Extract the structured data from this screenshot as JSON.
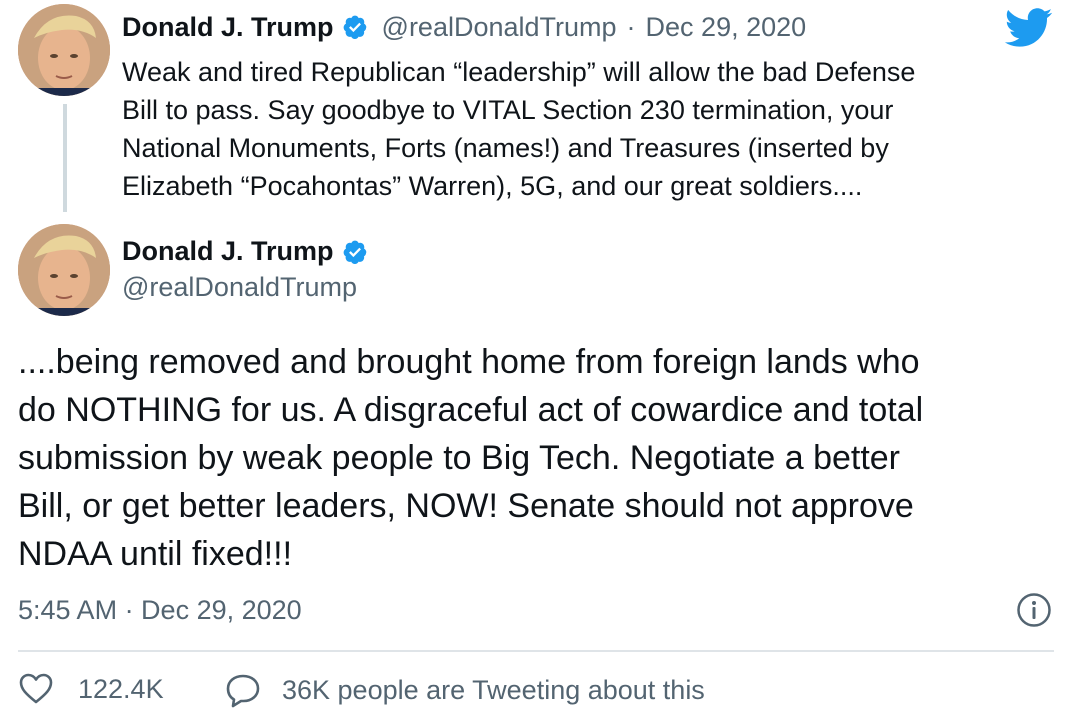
{
  "colors": {
    "accent": "#1d9bf0",
    "muted": "#536471",
    "text": "#0f1419"
  },
  "icons": {
    "logo": "twitter-bird-icon",
    "verified": "verified-badge-icon",
    "info": "info-icon",
    "like": "heart-icon",
    "reply": "speech-bubble-icon"
  },
  "parent_tweet": {
    "author_name": "Donald J. Trump",
    "author_handle": "@realDonaldTrump",
    "separator": "·",
    "date": "Dec 29, 2020",
    "lines": [
      "Weak and tired Republican “leadership” will allow the bad Defense",
      "Bill to pass. Say goodbye to VITAL Section 230 termination, your",
      "National Monuments, Forts (names!) and Treasures (inserted by",
      "Elizabeth “Pocahontas” Warren), 5G, and our great soldiers...."
    ]
  },
  "main_tweet": {
    "author_name": "Donald J. Trump",
    "author_handle": "@realDonaldTrump",
    "lines": [
      "....being removed and brought home from foreign lands who",
      "do NOTHING for us. A disgraceful act of cowardice and total",
      "submission by weak people to Big Tech. Negotiate a better",
      "Bill, or get better leaders, NOW! Senate should not approve",
      "NDAA until fixed!!!"
    ],
    "timestamp": "5:45 AM · Dec 29, 2020"
  },
  "engagement": {
    "likes": "122.4K",
    "tweeting_text": "36K people are Tweeting about this"
  }
}
